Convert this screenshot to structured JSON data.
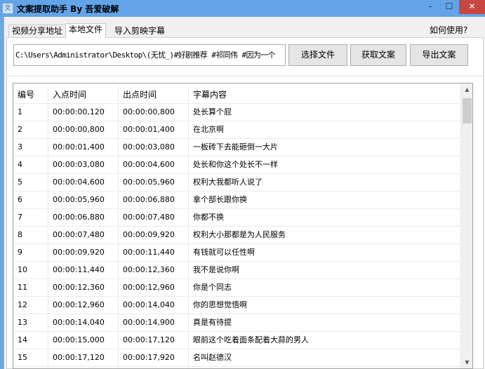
{
  "window": {
    "title": "文案提取助手 By 吾爱破解",
    "icon": "app-icon",
    "minimize": "-",
    "maximize": "☐",
    "close": "✕"
  },
  "tabs": [
    {
      "label": "视频分享地址",
      "active": false
    },
    {
      "label": "本地文件",
      "active": true
    },
    {
      "label": "导入剪映字幕",
      "active": false
    }
  ],
  "help_link": "如何使用?",
  "file_path": "C:\\Users\\Administrator\\Desktop\\(无忧_)#好剧推荐 #祁同伟 #因为一个",
  "buttons": {
    "choose": "选择文件",
    "fetch": "获取文案",
    "export": "导出文案"
  },
  "table": {
    "columns": [
      "编号",
      "入点时间",
      "出点时间",
      "字幕内容"
    ],
    "rows": [
      [
        "1",
        "00:00:00,120",
        "00:00:00,800",
        "处长算个屁"
      ],
      [
        "2",
        "00:00:00,800",
        "00:00:01,400",
        "在北京啊"
      ],
      [
        "3",
        "00:00:01,400",
        "00:00:03,080",
        "一板砖下去能砸倒一大片"
      ],
      [
        "4",
        "00:00:03,080",
        "00:00:04,600",
        "处长和你这个处长不一样"
      ],
      [
        "5",
        "00:00:04,600",
        "00:00:05,960",
        "权利大我都听人说了"
      ],
      [
        "6",
        "00:00:05,960",
        "00:00:06,880",
        "拿个部长跟你换"
      ],
      [
        "7",
        "00:00:06,880",
        "00:00:07,480",
        "你都不换"
      ],
      [
        "8",
        "00:00:07,480",
        "00:00:09,920",
        "权利大小那都是为人民服务"
      ],
      [
        "9",
        "00:00:09,920",
        "00:00:11,440",
        "有钱就可以任性啊"
      ],
      [
        "10",
        "00:00:11,440",
        "00:00:12,360",
        "我不是说你啊"
      ],
      [
        "11",
        "00:00:12,360",
        "00:00:12,960",
        "你是个同志"
      ],
      [
        "12",
        "00:00:12,960",
        "00:00:14,040",
        "你的思想觉悟啊"
      ],
      [
        "13",
        "00:00:14,040",
        "00:00:14,900",
        "真是有待提"
      ],
      [
        "14",
        "00:00:15,000",
        "00:00:17,120",
        "眼前这个吃着面条配着大蒜的男人"
      ],
      [
        "15",
        "00:00:17,120",
        "00:00:17,920",
        "名叫赵德汉"
      ],
      [
        "",
        "",
        "",
        ""
      ]
    ]
  },
  "colors": {
    "titlebar": "#63a4e8",
    "close": "#c7463f"
  }
}
